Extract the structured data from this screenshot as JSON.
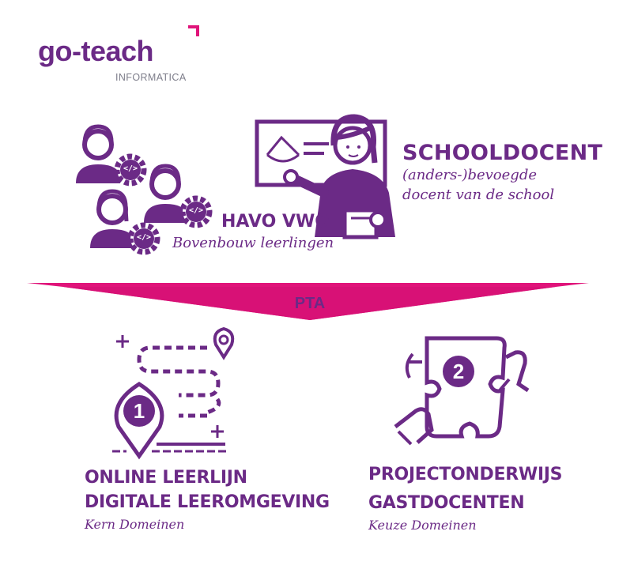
{
  "logo": {
    "name": "go-teach",
    "subtitle": "INFORMATICA"
  },
  "teacher": {
    "title": "SCHOOLDOCENT",
    "line1": "(anders-)bevoegde",
    "line2": "docent van de school"
  },
  "students": {
    "title": "HAVO VWO",
    "subtitle": "Bovenbouw leerlingen"
  },
  "banner": {
    "label": "PTA"
  },
  "left_track": {
    "badge": "1",
    "line1": "ONLINE LEERLIJN",
    "line2": "DIGITALE LEEROMGEVING",
    "note": "Kern Domeinen"
  },
  "right_track": {
    "badge": "2",
    "line1": "PROJECTONDERWIJS",
    "line2": "GASTDOCENTEN",
    "note": "Keuze Domeinen"
  },
  "icons": {
    "code_symbol": "</>"
  },
  "colors": {
    "purple": "#6b2a86",
    "magenta": "#e0147a",
    "grey": "#7d7d8a"
  }
}
